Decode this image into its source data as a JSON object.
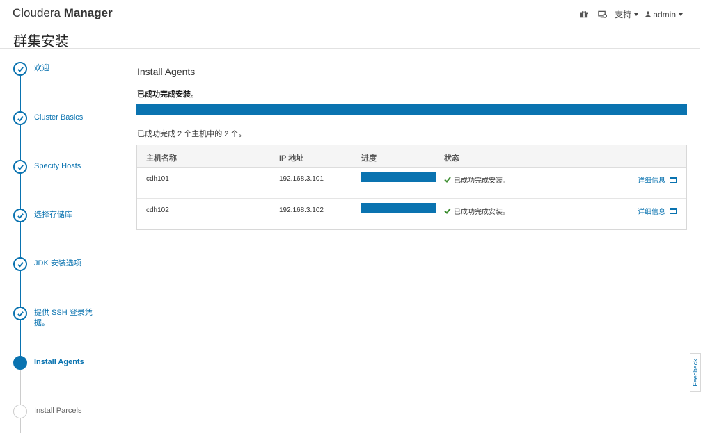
{
  "app": {
    "brand_light": "Cloudera",
    "brand_bold": "Manager"
  },
  "nav": {
    "icons": [
      "gift-icon",
      "cloud-monitor-icon"
    ],
    "support_label": "支持",
    "user_label": "admin"
  },
  "page": {
    "title": "群集安装"
  },
  "sidebar": {
    "steps": [
      {
        "label": "欢迎",
        "state": "done"
      },
      {
        "label": "Cluster Basics",
        "state": "done"
      },
      {
        "label": "Specify Hosts",
        "state": "done"
      },
      {
        "label": "选择存储库",
        "state": "done"
      },
      {
        "label": "JDK 安装选项",
        "state": "done"
      },
      {
        "label": "提供 SSH 登录凭据。",
        "state": "done"
      },
      {
        "label": "Install Agents",
        "state": "current"
      },
      {
        "label": "Install Parcels",
        "state": "pending"
      }
    ]
  },
  "main": {
    "heading": "Install Agents",
    "status": "已成功完成安装。",
    "overall_progress": 1.0,
    "summary": "已成功完成 2 个主机中的 2 个。",
    "table": {
      "headers": [
        "主机名称",
        "IP 地址",
        "进度",
        "状态"
      ],
      "rows": [
        {
          "host": "cdh101",
          "ip": "192.168.3.101",
          "progress": 1.0,
          "status": "已成功完成安装。",
          "details": "详细信息"
        },
        {
          "host": "cdh102",
          "ip": "192.168.3.102",
          "progress": 1.0,
          "status": "已成功完成安装。",
          "details": "详细信息"
        }
      ]
    }
  },
  "feedback": {
    "label": "Feedback"
  },
  "colors": {
    "accent": "#0a73b0",
    "success": "#3c8d2f"
  }
}
